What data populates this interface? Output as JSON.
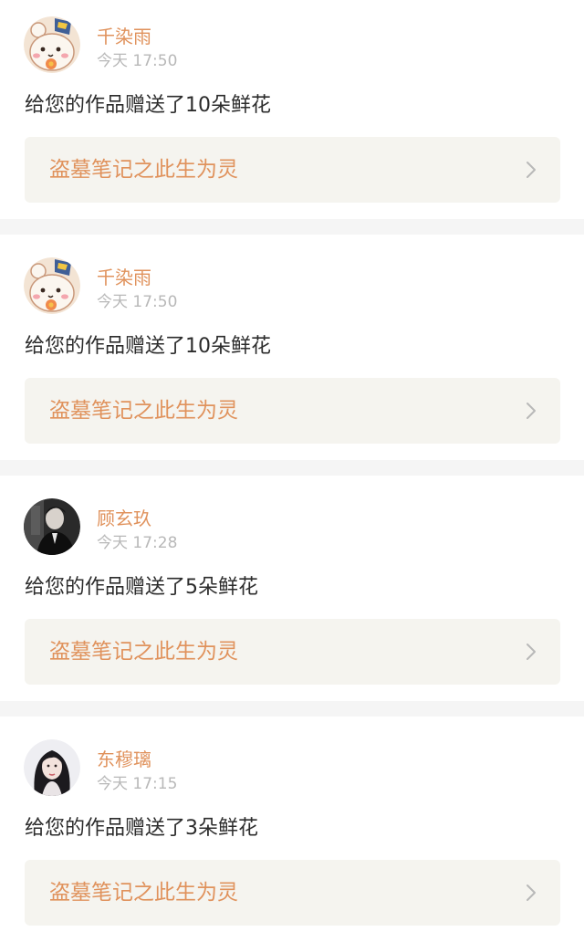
{
  "notifications": [
    {
      "user_name": "千染雨",
      "time": "今天 17:50",
      "message": "给您的作品赠送了10朵鲜花",
      "work_title": "盗墓笔记之此生为灵",
      "avatar_icon": "cartoon-bear-avatar"
    },
    {
      "user_name": "千染雨",
      "time": "今天 17:50",
      "message": "给您的作品赠送了10朵鲜花",
      "work_title": "盗墓笔记之此生为灵",
      "avatar_icon": "cartoon-bear-avatar"
    },
    {
      "user_name": "顾玄玖",
      "time": "今天 17:28",
      "message": "给您的作品赠送了5朵鲜花",
      "work_title": "盗墓笔记之此生为灵",
      "avatar_icon": "dark-portrait-avatar"
    },
    {
      "user_name": "东穆璃",
      "time": "今天 17:15",
      "message": "给您的作品赠送了3朵鲜花",
      "work_title": "盗墓笔记之此生为灵",
      "avatar_icon": "girl-portrait-avatar"
    }
  ],
  "colors": {
    "accent": "#e0925c",
    "page_background": "#f5f5f5",
    "card_background": "#ffffff",
    "link_background": "#f5f4ef",
    "time_text": "#b8b8b8",
    "message_text": "#2c2c2c"
  }
}
